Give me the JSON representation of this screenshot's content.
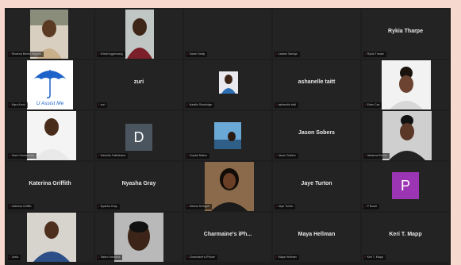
{
  "participants": [
    {
      "display": "",
      "tag": "Rowena Bernie Mayers"
    },
    {
      "display": "",
      "tag": "Kristel Agyemang"
    },
    {
      "display": "",
      "tag": "Sarah Sealy"
    },
    {
      "display": "",
      "tag": "Lisabel Sandys"
    },
    {
      "display": "Rykia Tharpe",
      "tag": "Rykia Tharpe"
    },
    {
      "display": "U Assist Me",
      "tag": "Myra Arnol"
    },
    {
      "display": "zuri",
      "tag": "zuri"
    },
    {
      "display": "",
      "tag": "Natalie Stoutridge"
    },
    {
      "display": "ashanelle taitt",
      "tag": "ashanelle taitt"
    },
    {
      "display": "",
      "tag": "Eden Cas"
    },
    {
      "display": "",
      "tag": "Zack Cheeseman"
    },
    {
      "display": "D",
      "tag": "Danielle Fakirkhanu"
    },
    {
      "display": "",
      "tag": "Crystal Nation"
    },
    {
      "display": "Jason Sobers",
      "tag": "Jason Sobers"
    },
    {
      "display": "",
      "tag": "Jahanna Brown"
    },
    {
      "display": "Katerina Griffith",
      "tag": "Katerina Griffith"
    },
    {
      "display": "Nyasha Gray",
      "tag": "Nyasha Gray"
    },
    {
      "display": "",
      "tag": "Alesha Selhgart"
    },
    {
      "display": "Jaye Turton",
      "tag": "Jaye Turton"
    },
    {
      "display": "P",
      "tag": "P Bovel"
    },
    {
      "display": "",
      "tag": "Joela"
    },
    {
      "display": "",
      "tag": "Tafaro Ihedioha"
    },
    {
      "display": "Charmaine's iPh...",
      "tag": "Charmaine's iPhone"
    },
    {
      "display": "Maya Hellman",
      "tag": "Maya Hellman"
    },
    {
      "display": "Keri T. Mapp",
      "tag": "Keri T. Mapp"
    }
  ],
  "colors": {
    "tile_bg": "#232323",
    "mic_muted": "#e0403a",
    "avatar_d": "#4a5560",
    "avatar_p": "#9c35b3",
    "umbrella": "#1e63c9"
  }
}
